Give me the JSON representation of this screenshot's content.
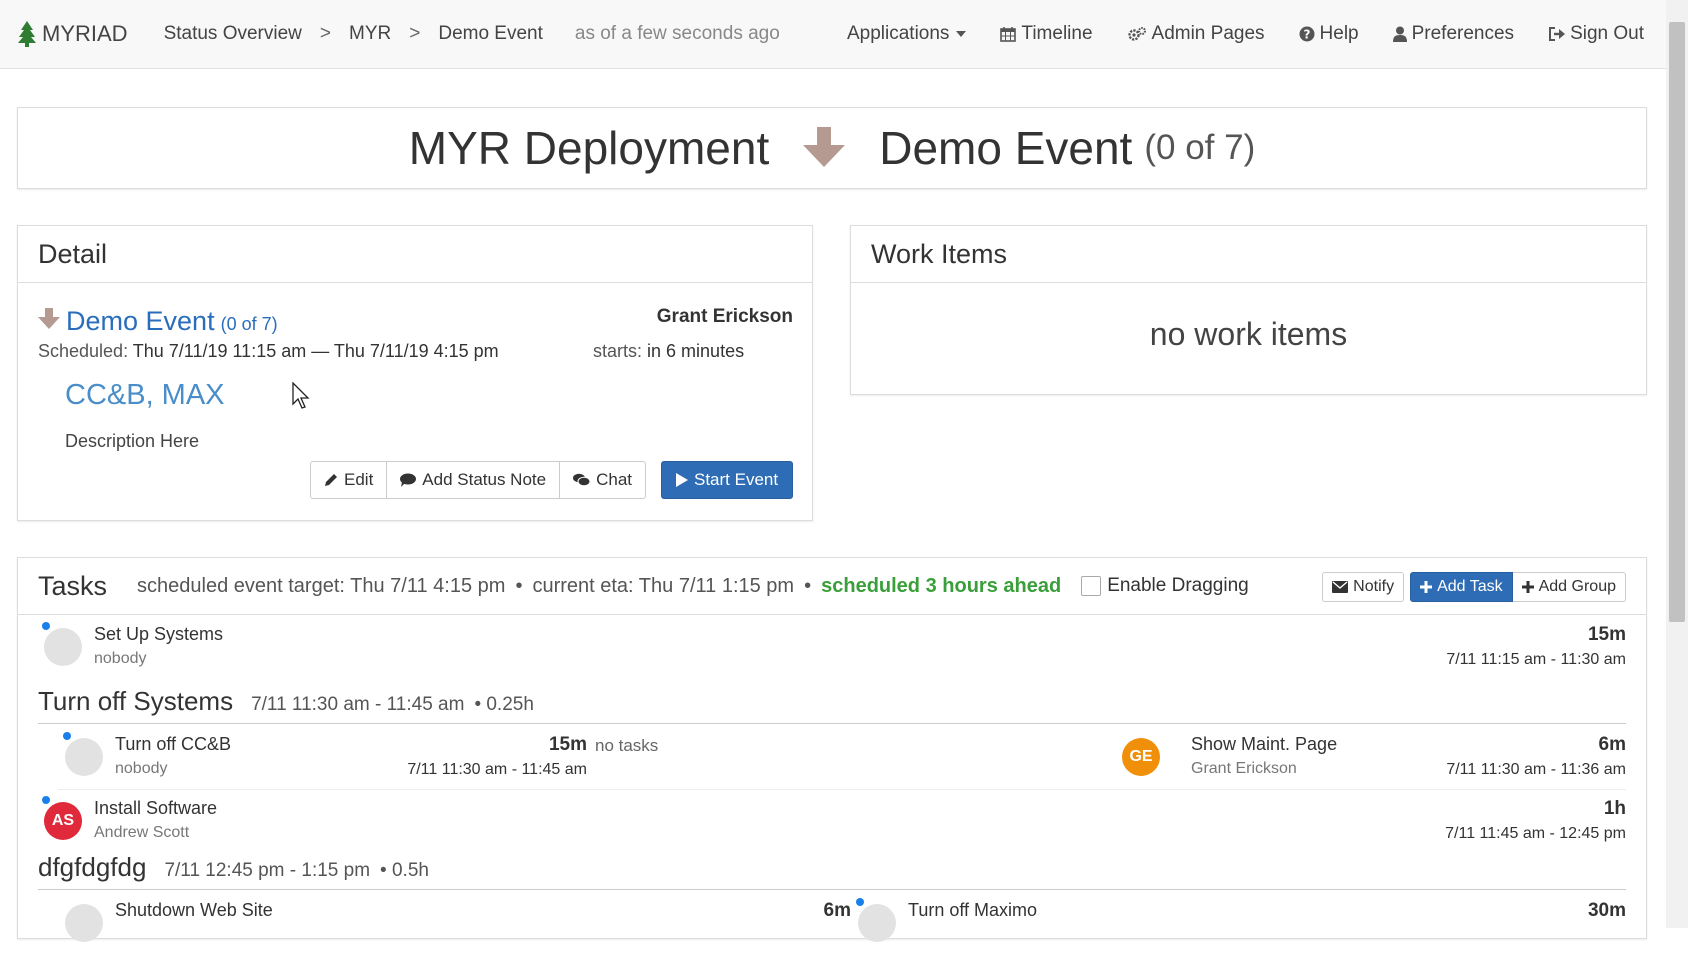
{
  "nav": {
    "brand": "MYRIAD",
    "breadcrumbs": [
      "Status Overview",
      "MYR",
      "Demo Event"
    ],
    "separator": ">",
    "as_of": "as of a few seconds ago",
    "links": {
      "applications": "Applications",
      "timeline": "Timeline",
      "admin": "Admin Pages",
      "help": "Help",
      "preferences": "Preferences",
      "signout": "Sign Out"
    }
  },
  "header": {
    "deployment": "MYR Deployment",
    "event": "Demo Event",
    "count": "(0 of 7)"
  },
  "detail": {
    "title": "Detail",
    "event_name": "Demo Event",
    "event_count": "(0 of 7)",
    "owner": "Grant Erickson",
    "scheduled_label": "Scheduled:",
    "scheduled_value": "Thu 7/11/19 11:15 am — Thu 7/11/19 4:15 pm",
    "starts_label": "starts:",
    "starts_value": "in 6 minutes",
    "systems": "CC&B, MAX",
    "description": "Description Here",
    "buttons": {
      "edit": "Edit",
      "status_note": "Add Status Note",
      "chat": "Chat",
      "start": "Start Event"
    }
  },
  "work_items": {
    "title": "Work Items",
    "empty": "no work items"
  },
  "tasks": {
    "title": "Tasks",
    "target": "scheduled event target: Thu 7/11 4:15 pm",
    "eta": "current eta: Thu 7/11 1:15 pm",
    "ahead": "scheduled 3 hours ahead",
    "bullet": "•",
    "enable_dragging": "Enable Dragging",
    "buttons": {
      "notify": "Notify",
      "add_task": "Add Task",
      "add_group": "Add Group"
    },
    "no_tasks": "no tasks",
    "items": [
      {
        "name": "Set Up Systems",
        "owner": "nobody",
        "duration": "15m",
        "time": "7/11 11:15 am - 11:30 am"
      },
      {
        "name": "Turn off CC&B",
        "owner": "nobody",
        "duration": "15m",
        "time": "7/11 11:30 am - 11:45 am"
      },
      {
        "name": "Show Maint. Page",
        "owner": "Grant Erickson",
        "duration": "6m",
        "time": "7/11 11:30 am - 11:36 am",
        "initials": "GE",
        "color": "#f0900a"
      },
      {
        "name": "Install Software",
        "owner": "Andrew Scott",
        "duration": "1h",
        "time": "7/11 11:45 am - 12:45 pm",
        "initials": "AS",
        "color": "#e0293a"
      },
      {
        "name": "Shutdown Web Site",
        "owner": "",
        "duration": "6m",
        "time": ""
      },
      {
        "name": "Turn off Maximo",
        "owner": "",
        "duration": "30m",
        "time": ""
      }
    ],
    "groups": [
      {
        "name": "Turn off Systems",
        "time": "7/11 11:30 am - 11:45 am",
        "hours": "• 0.25h"
      },
      {
        "name": "dfgfdgfdg",
        "time": "7/11 12:45 pm - 1:15 pm",
        "hours": "• 0.5h"
      }
    ]
  },
  "colors": {
    "primary": "#2e6db5",
    "link": "#2a6ebb",
    "success": "#3a9f3a",
    "status_dot": "#1a7fe8"
  }
}
